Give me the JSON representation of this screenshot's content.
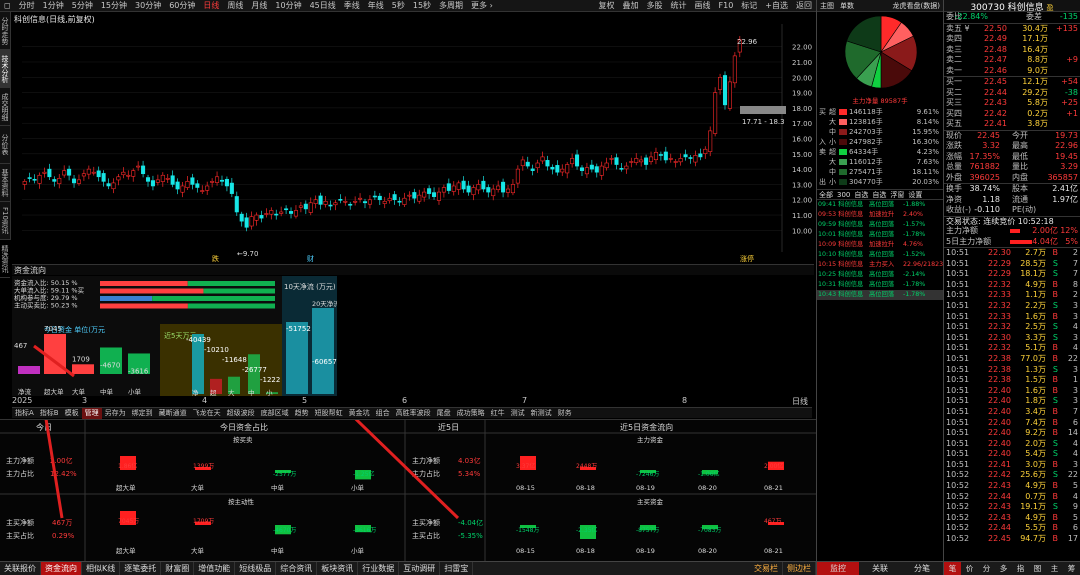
{
  "toolbar": {
    "left": [
      "◻",
      "分时",
      "1分钟",
      "5分钟",
      "15分钟",
      "30分钟",
      "60分钟",
      "日线",
      "周线",
      "月线",
      "10分钟",
      "45日线",
      "季线",
      "年线",
      "5秒",
      "15秒",
      "多周期",
      "更多 ›"
    ],
    "active": "日线",
    "right": [
      "复权",
      "叠加",
      "多股",
      "统计",
      "画线",
      "F10",
      "标记",
      "+自选",
      "返回"
    ]
  },
  "left_tabs": [
    "分时走势",
    "技术分析",
    "成交明细",
    "分价表",
    "基本资料",
    "F10资讯",
    "精选资讯"
  ],
  "chart": {
    "title": "科创信息(日线,前复权)",
    "y_ticks": [
      "22.00",
      "21.00",
      "20.00",
      "19.00",
      "18.00",
      "17.00",
      "16.00",
      "15.00",
      "14.00",
      "13.00",
      "12.00",
      "11.00",
      "10.00"
    ],
    "x_ticks": [
      "2025",
      "3",
      "4",
      "5",
      "6",
      "7",
      "8",
      "日线"
    ],
    "high_label": "22.96",
    "low_label": "9.70",
    "range_label": "17.71 - 18.3",
    "markers": [
      "跌",
      "财",
      "涨停"
    ]
  },
  "flow": {
    "title": "资金流向",
    "rows": [
      {
        "label": "资金流入比",
        "value": "50.15 %"
      },
      {
        "label": "大单流入比",
        "value": "59.11 %买"
      },
      {
        "label": "机构参与度",
        "value": "29.79 %"
      },
      {
        "label": "主动买卖比",
        "value": "50.23 %"
      }
    ],
    "today_title": "今日资金 单位(万元",
    "today_values": [
      "467",
      "7045",
      "1709",
      "-4670",
      "-3616"
    ],
    "today_labels": [
      "净流",
      "超大单",
      "大单",
      "中单",
      "小单"
    ],
    "d5_title": "近5天万元",
    "d5_values": [
      "-40439",
      "-10210",
      "-11648",
      "-26777",
      "-1222"
    ],
    "d5_labels": [
      "净",
      "超",
      "大",
      "中",
      "小"
    ],
    "d10_title": "10天净流 (万元)",
    "d10_values": [
      "-51752",
      "-60657"
    ],
    "d20_label": "20天净流"
  },
  "bottom_tabs": [
    "指标A",
    "指标B",
    "模板",
    "管理",
    "另存为",
    "绑定到",
    "藏断通道",
    "飞龙在天",
    "超级波段",
    "底部区域",
    "趋势",
    "短股帮虹",
    "黄金坑",
    "组合",
    "高胜率波段",
    "尾盘",
    "成功策略",
    "红牛",
    "测试",
    "新测试",
    "财务"
  ],
  "bottom_active": "管理",
  "cf": {
    "today": {
      "title": "今日",
      "net_label": "主力净额",
      "net_val": "2.00亿",
      "ratio_label": "主力占比",
      "ratio_val": "12.42%",
      "buy_net_label": "主买净额",
      "buy_net_val": "467万",
      "buy_ratio_label": "主买占比",
      "buy_ratio_val": "0.29%"
    },
    "ratio": {
      "title": "今日资金占比",
      "sub1": "按买卖",
      "sub2": "按主动性",
      "v1": [
        "1.86亿",
        "1399万",
        "-2577万",
        "-1.25亿"
      ],
      "v2": [
        "7045万",
        "1709万",
        "-4670万",
        "-3616万"
      ],
      "cats": [
        "超大单",
        "大单",
        "中单",
        "小单"
      ]
    },
    "d5": {
      "title": "近5日",
      "net_label": "主力净额",
      "net_val": "4.03亿",
      "ratio_label": "主力占比",
      "ratio_val": "5.34%",
      "buy_net_label": "主买净额",
      "buy_net_val": "-4.04亿",
      "buy_ratio_label": "主买占比",
      "buy_ratio_val": "-5.35%"
    },
    "d5flow": {
      "title": "近5日资金流向",
      "sub1": "主力资金",
      "sub2": "主买资金",
      "v1": [
        "3.37亿",
        "2448万",
        "-7246万",
        "-1.06亿",
        "2.00亿"
      ],
      "v2": [
        "-1548万",
        "-2.35亿",
        "-8757万",
        "-7083万",
        "467万"
      ],
      "dates": [
        "08-15",
        "08-18",
        "08-19",
        "08-20",
        "08-21"
      ]
    }
  },
  "status_bar": [
    "关联报价",
    "资金流向",
    "相似K线",
    "逐笔委托",
    "财富圈",
    "增值功能",
    "短线极品",
    "综合资讯",
    "板块资讯",
    "行业数据",
    "互动调研",
    "扫雷宝"
  ],
  "status_active": "资金流向",
  "status_right": [
    "交易栏",
    "侧边栏"
  ],
  "mid": {
    "tabs": [
      "主图",
      "单数",
      "龙虎看盘(数据)"
    ],
    "pie_label": "主力净量 89587手",
    "table": [
      {
        "side": "买",
        "k": "超",
        "v": "146118手",
        "p": "9.61%",
        "c": "#ff2a2a"
      },
      {
        "side": "",
        "k": "大",
        "v": "123816手",
        "p": "8.14%",
        "c": "#ff6060"
      },
      {
        "side": "",
        "k": "中",
        "v": "242703手",
        "p": "15.95%",
        "c": "#8a1a1a"
      },
      {
        "side": "入",
        "k": "小",
        "v": "247982手",
        "p": "16.30%",
        "c": "#4a0a0a"
      },
      {
        "side": "卖",
        "k": "超",
        "v": "64334手",
        "p": "4.23%",
        "c": "#10d040"
      },
      {
        "side": "",
        "k": "大",
        "v": "116012手",
        "p": "7.63%",
        "c": "#3aa050"
      },
      {
        "side": "",
        "k": "中",
        "v": "275471手",
        "p": "18.11%",
        "c": "#1f6a2c"
      },
      {
        "side": "出",
        "k": "小",
        "v": "304770手",
        "p": "20.03%",
        "c": "#0e3a18"
      }
    ],
    "sub_tabs": [
      "全部",
      "300",
      "自选",
      "自选",
      "浮窗",
      "设置"
    ],
    "news": [
      {
        "t": "09:41 科创信息",
        "s": "高位回落",
        "p": "-1.88%",
        "c": "grn"
      },
      {
        "t": "09:53 科创信息",
        "s": "加速拉升",
        "p": "2.40%",
        "c": "red"
      },
      {
        "t": "09:59 科创信息",
        "s": "高位回落",
        "p": "-1.57%",
        "c": "grn"
      },
      {
        "t": "10:01 科创信息",
        "s": "高位回落",
        "p": "-1.78%",
        "c": "grn"
      },
      {
        "t": "10:09 科创信息",
        "s": "加速拉升",
        "p": "4.76%",
        "c": "red"
      },
      {
        "t": "10:10 科创信息",
        "s": "高位回落",
        "p": "-1.52%",
        "c": "grn"
      },
      {
        "t": "10:15 科创信息",
        "s": "主力买入",
        "p": "22.96/21823",
        "c": "red"
      },
      {
        "t": "10:25 科创信息",
        "s": "高位回落",
        "p": "-2.14%",
        "c": "grn"
      },
      {
        "t": "10:31 科创信息",
        "s": "高位回落",
        "p": "-1.78%",
        "c": "grn"
      },
      {
        "t": "10:43 科创信息",
        "s": "高位回落",
        "p": "-1.78%",
        "c": "grn"
      }
    ],
    "bottom": [
      "监控",
      "关联",
      "分笔"
    ]
  },
  "quote": {
    "header": "300730 科创信息",
    "tag": "盈",
    "ratio": [
      "委比",
      "-22.84%",
      "委差",
      "-135"
    ],
    "asks": [
      [
        "卖五 ¥",
        "22.50",
        "30.4万",
        "+135"
      ],
      [
        "卖四",
        "22.49",
        "17.1万",
        ""
      ],
      [
        "卖三",
        "22.48",
        "16.4万",
        ""
      ],
      [
        "卖二",
        "22.47",
        "8.8万",
        "+9"
      ],
      [
        "卖一",
        "22.46",
        "9.0万",
        ""
      ]
    ],
    "bids": [
      [
        "买一",
        "22.45",
        "12.1万",
        "+54"
      ],
      [
        "买二",
        "22.44",
        "29.2万",
        "-38"
      ],
      [
        "买三",
        "22.43",
        "5.8万",
        "+25"
      ],
      [
        "买四",
        "22.42",
        "0.2万",
        "+1"
      ],
      [
        "买五",
        "22.41",
        "3.8万",
        ""
      ]
    ],
    "stats": [
      [
        "现价",
        "22.45",
        "今开",
        "19.73"
      ],
      [
        "涨跌",
        "3.32",
        "最高",
        "22.96"
      ],
      [
        "涨幅",
        "17.35%",
        "最低",
        "19.45"
      ],
      [
        "总量",
        "761882",
        "量比",
        "3.29"
      ],
      [
        "外盘",
        "396025",
        "内盘",
        "365857"
      ]
    ],
    "stats2": [
      [
        "换手",
        "38.74%",
        "股本",
        "2.41亿"
      ],
      [
        "净资",
        "1.18",
        "流通",
        "1.97亿"
      ],
      [
        "收益(-)",
        "-0.110",
        "PE(动)",
        ""
      ]
    ],
    "status": "交易状态: 连续竞价 10:52:18",
    "main1": [
      "主力净额",
      "2.00亿",
      "12%"
    ],
    "main5": [
      "5日主力净额",
      "4.04亿",
      "5%"
    ],
    "ticks": [
      [
        "10:51",
        "22.30",
        "2.7万",
        "B",
        "2"
      ],
      [
        "10:51",
        "22.29",
        "28.5万",
        "S",
        "7"
      ],
      [
        "10:51",
        "22.29",
        "18.1万",
        "S",
        "7"
      ],
      [
        "10:51",
        "22.32",
        "4.9万",
        "B",
        "8"
      ],
      [
        "10:51",
        "22.33",
        "1.1万",
        "B",
        "2"
      ],
      [
        "10:51",
        "22.32",
        "2.2万",
        "S",
        "3"
      ],
      [
        "10:51",
        "22.33",
        "1.6万",
        "B",
        "3"
      ],
      [
        "10:51",
        "22.32",
        "2.5万",
        "S",
        "4"
      ],
      [
        "10:51",
        "22.30",
        "3.3万",
        "S",
        "3"
      ],
      [
        "10:51",
        "22.32",
        "5.1万",
        "B",
        "4"
      ],
      [
        "10:51",
        "22.38",
        "77.0万",
        "B",
        "22"
      ],
      [
        "10:51",
        "22.38",
        "1.3万",
        "S",
        "3"
      ],
      [
        "10:51",
        "22.38",
        "1.5万",
        "B",
        "1"
      ],
      [
        "10:51",
        "22.40",
        "1.6万",
        "B",
        "3"
      ],
      [
        "10:51",
        "22.40",
        "1.8万",
        "S",
        "3"
      ],
      [
        "10:51",
        "22.40",
        "3.4万",
        "B",
        "7"
      ],
      [
        "10:51",
        "22.40",
        "7.4万",
        "B",
        "6"
      ],
      [
        "10:51",
        "22.40",
        "9.2万",
        "B",
        "14"
      ],
      [
        "10:51",
        "22.40",
        "2.0万",
        "S",
        "4"
      ],
      [
        "10:51",
        "22.40",
        "5.4万",
        "S",
        "4"
      ],
      [
        "10:51",
        "22.41",
        "3.0万",
        "B",
        "3"
      ],
      [
        "10:52",
        "22.42",
        "25.6万",
        "S",
        "22"
      ],
      [
        "10:52",
        "22.43",
        "4.9万",
        "B",
        "5"
      ],
      [
        "10:52",
        "22.44",
        "0.7万",
        "B",
        "4"
      ],
      [
        "10:52",
        "22.43",
        "19.1万",
        "S",
        "9"
      ],
      [
        "10:52",
        "22.43",
        "4.9万",
        "B",
        "5"
      ],
      [
        "10:52",
        "22.44",
        "5.5万",
        "B",
        "6"
      ],
      [
        "10:52",
        "22.45",
        "94.7万",
        "B",
        "17"
      ]
    ],
    "tick_tabs": [
      "笔",
      "价",
      "分",
      "多",
      "指",
      "图",
      "主",
      "筹"
    ]
  }
}
